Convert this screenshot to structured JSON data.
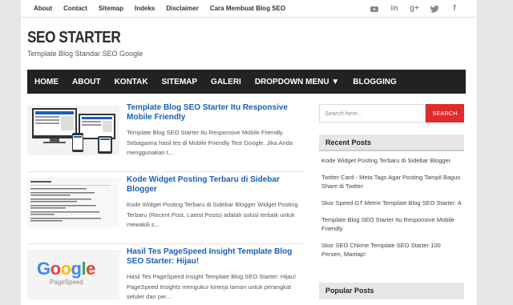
{
  "top_links": [
    "About",
    "Contact",
    "Sitemap",
    "Indeks",
    "Disclaimer",
    "Cara Membuat Blog SEO"
  ],
  "social_icons": [
    "youtube-icon",
    "linkedin-icon",
    "google-plus-icon",
    "twitter-icon",
    "facebook-icon"
  ],
  "brand": {
    "title": "SEO STARTER",
    "tagline": "Template Blog Standar SEO Google"
  },
  "nav": [
    "HOME",
    "ABOUT",
    "KONTAK",
    "SITEMAP",
    "GALERI",
    "DROPDOWN MENU ▼",
    "BLOGGING"
  ],
  "posts": [
    {
      "title": "Template Blog SEO Starter Itu Responsive Mobile Friendly",
      "excerpt": "Template Blog SEO Starter Itu Responsive Mobile Friendly. Sebagaima hasil tes di Mobile Friendly Test Google. Jika Anda menggunakan t..."
    },
    {
      "title": "Kode Widget Posting Terbaru di Sidebar Blogger",
      "excerpt": "Kode Widget Posting Terbaru di Sidebar Blogger Widget Posting Terbaru (Recent Post, Latest Posts) adalah solusi terbaik untuk mewakili s..."
    },
    {
      "title": "Hasil Tes PageSpeed Insight Template Blog SEO Starter: Hijau!",
      "excerpt": "Hasil Tes PageSpeed Insight Template Blog SEO Starter: Hijau! PageSpeed Insights mengukur kinerja laman untuk perangkat seluler dan per..."
    }
  ],
  "thumb3": {
    "brand": "Google",
    "sub": "PageSpeed"
  },
  "search": {
    "placeholder": "Search here...",
    "button": "SEARCH"
  },
  "recent_posts": {
    "title": "Recent Posts",
    "items": [
      "Kode Widget Posting Terbaru di Sidebar Blogger",
      "Twitter Card - Meta Tags Agar Posting Tampil Bagus Share di Twitter",
      "Skor Speed GT Metrix Template Blog SEO Starter: A",
      "Template Blog SEO Starter Itu Responsive Mobile Friendly",
      "Skor SEO Chkme Template SEO Starter 100 Persen, Mantap!"
    ]
  },
  "popular_posts": {
    "title": "Popular Posts"
  },
  "colors": {
    "nav_bg": "#222222",
    "link": "#1a5fb4",
    "search_button": "#e02b2b"
  }
}
